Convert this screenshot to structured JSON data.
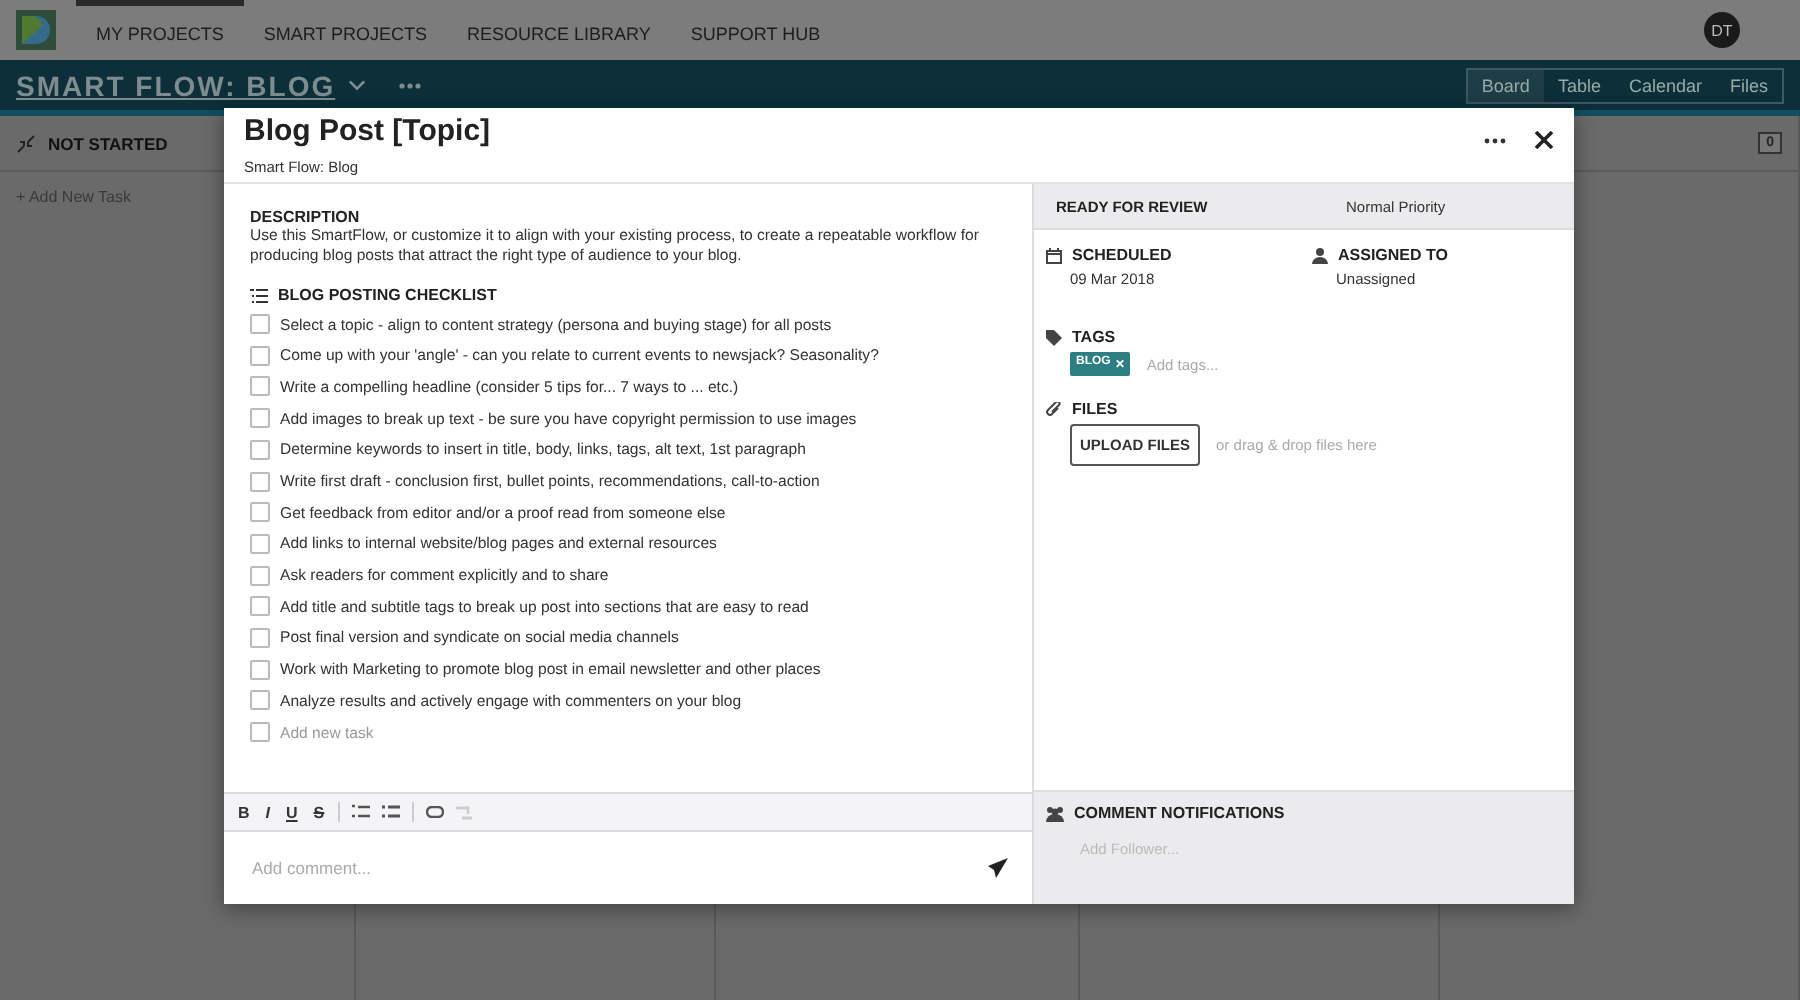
{
  "nav": {
    "items": [
      {
        "label": "MY PROJECTS",
        "selected": true
      },
      {
        "label": "SMART PROJECTS",
        "selected": false
      },
      {
        "label": "RESOURCE LIBRARY",
        "selected": false
      },
      {
        "label": "SUPPORT HUB",
        "selected": false
      }
    ],
    "avatar": "DT"
  },
  "project": {
    "title": "SMART FLOW: BLOG",
    "views": [
      {
        "label": "Board",
        "selected": true
      },
      {
        "label": "Table",
        "selected": false
      },
      {
        "label": "Calendar",
        "selected": false
      },
      {
        "label": "Files",
        "selected": false
      }
    ]
  },
  "board": {
    "column": {
      "title": "NOT STARTED",
      "count": "0",
      "add": "+ Add New Task"
    }
  },
  "modal": {
    "title": "Blog Post [Topic]",
    "subtitle": "Smart Flow: Blog",
    "description": {
      "heading": "DESCRIPTION",
      "text": "Use this SmartFlow, or customize it to align with your existing process, to create a repeatable workflow for producing blog posts that attract the right type of audience to your blog."
    },
    "checklist": {
      "heading": "BLOG POSTING CHECKLIST",
      "items": [
        {
          "text": "Select a topic - align to content strategy (persona and buying stage) for all posts",
          "checked": false
        },
        {
          "text": "Come up with your 'angle' - can you relate to current events to newsjack? Seasonality?",
          "checked": false
        },
        {
          "text": "Write a compelling headline (consider 5 tips for... 7 ways to ... etc.)",
          "checked": false
        },
        {
          "text": "Add images to break up text - be sure you have copyright permission to use images",
          "checked": false
        },
        {
          "text": "Determine keywords to insert in title, body, links, tags, alt text, 1st paragraph",
          "checked": false
        },
        {
          "text": "Write first draft - conclusion first, bullet points, recommendations, call-to-action",
          "checked": false
        },
        {
          "text": "Get feedback from editor and/or a proof read from someone else",
          "checked": false
        },
        {
          "text": "Add links to internal website/blog pages and external resources",
          "checked": false
        },
        {
          "text": "Ask readers for comment explicitly and to share",
          "checked": false
        },
        {
          "text": "Add title and subtitle tags to break up post into sections that are easy to read",
          "checked": false
        },
        {
          "text": "Post final version and syndicate on social media channels",
          "checked": false
        },
        {
          "text": "Work with Marketing to promote blog post in email newsletter and other places",
          "checked": false
        },
        {
          "text": "Analyze results and actively engage with commenters on your blog",
          "checked": false
        }
      ],
      "new_task_placeholder": "Add new task",
      "new_task_checked": false
    },
    "format_buttons": [
      "B",
      "I",
      "U",
      "S"
    ],
    "comment": {
      "placeholder": "Add comment..."
    },
    "status": "READY FOR REVIEW",
    "priority": "Normal Priority",
    "scheduled": {
      "label": "SCHEDULED",
      "value": "09 Mar 2018"
    },
    "assigned": {
      "label": "ASSIGNED TO",
      "value": "Unassigned"
    },
    "tags": {
      "label": "TAGS",
      "items": [
        {
          "label": "BLOG",
          "remove": "✕"
        }
      ],
      "placeholder": "Add tags..."
    },
    "files": {
      "label": "FILES",
      "button": "UPLOAD FILES",
      "hint": "or drag & drop files here"
    },
    "notifications": {
      "label": "COMMENT NOTIFICATIONS",
      "placeholder": "Add Follower..."
    }
  }
}
